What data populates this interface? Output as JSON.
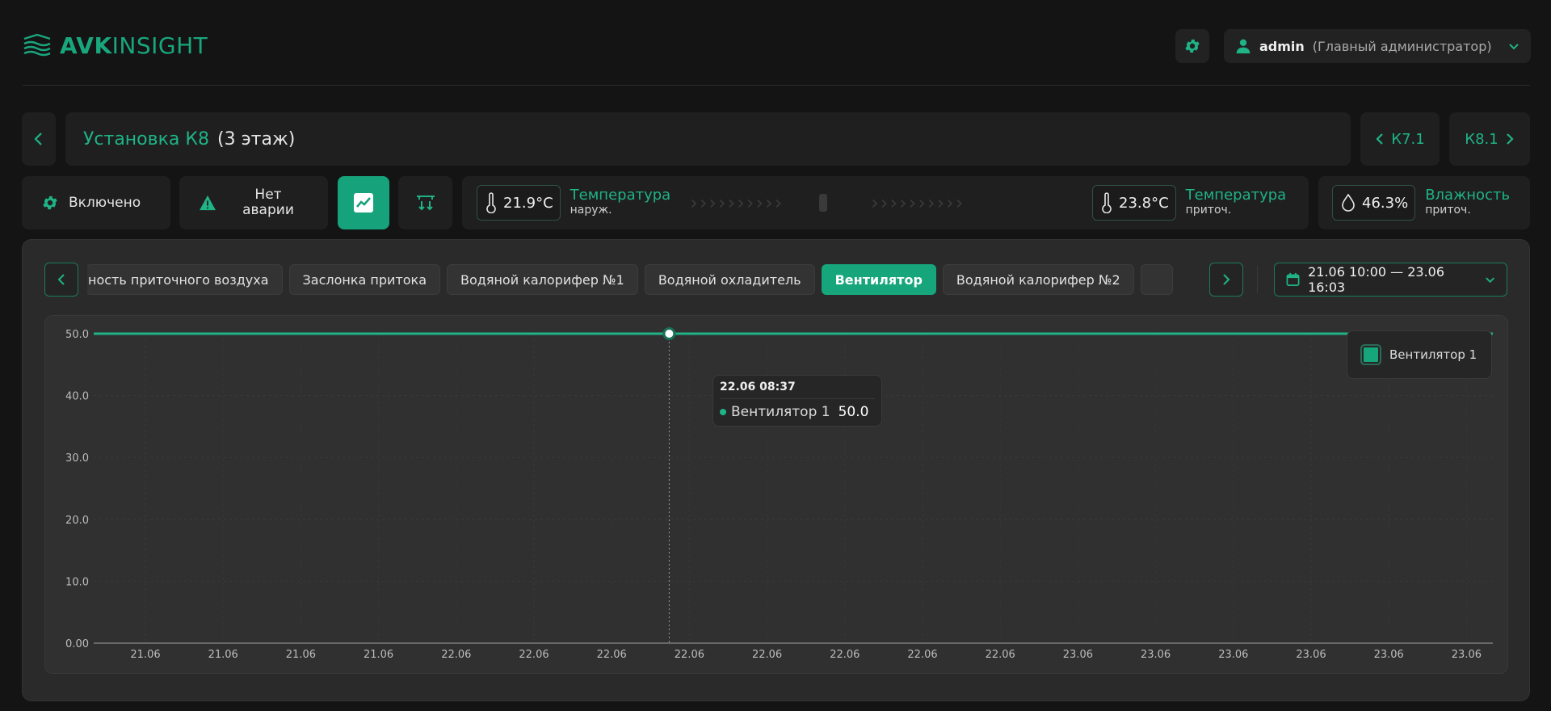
{
  "app": {
    "logo_bold": "AVK",
    "logo_thin": "INSIGHT"
  },
  "user": {
    "name": "admin",
    "role": "(Главный администратор)"
  },
  "unit": {
    "name": "Установка К8",
    "floor": "(3 этаж)",
    "prev": "К7.1",
    "next": "К8.1"
  },
  "status": {
    "power": "Включено",
    "alarm": "Нет аварии"
  },
  "metrics": {
    "outdoor_temp": {
      "value": "21.9°C",
      "label": "Температура",
      "sub": "наруж."
    },
    "supply_temp": {
      "value": "23.8°C",
      "label": "Температура",
      "sub": "приточ."
    },
    "supply_humidity": {
      "value": "46.3%",
      "label": "Влажность",
      "sub": "приточ."
    }
  },
  "tabs": [
    {
      "label": "ность приточного воздуха",
      "active": false
    },
    {
      "label": "Заслонка притока",
      "active": false
    },
    {
      "label": "Водяной калорифер №1",
      "active": false
    },
    {
      "label": "Водяной охладитель",
      "active": false
    },
    {
      "label": "Вентилятор",
      "active": true
    },
    {
      "label": "Водяной калорифер №2",
      "active": false
    },
    {
      "label": "",
      "active": false
    }
  ],
  "date_range": "21.06 10:00 — 23.06 16:03",
  "tooltip": {
    "date": "22.06 08:37",
    "series": "Вентилятор 1",
    "value": "50.0"
  },
  "legend": {
    "label": "Вентилятор 1"
  },
  "colors": {
    "accent": "#17a67c",
    "line": "#1fb386"
  },
  "icons": {
    "logo": "waves-logo-icon",
    "settings": "gear-icon",
    "user": "user-icon",
    "power": "gear-icon",
    "alarm": "warning-icon",
    "chart": "chart-line-icon",
    "flow": "flow-icon",
    "thermometer": "thermometer-icon",
    "drop": "drop-icon",
    "calendar": "calendar-icon"
  },
  "chart_data": {
    "type": "line",
    "ylim": [
      0,
      50
    ],
    "y_ticks": [
      "0.00",
      "10.0",
      "20.0",
      "30.0",
      "40.0",
      "50.0"
    ],
    "x_ticks": [
      "21.06",
      "21.06",
      "21.06",
      "21.06",
      "22.06",
      "22.06",
      "22.06",
      "22.06",
      "22.06",
      "22.06",
      "22.06",
      "22.06",
      "23.06",
      "23.06",
      "23.06",
      "23.06",
      "23.06",
      "23.06"
    ],
    "series": [
      {
        "name": "Вентилятор 1",
        "values": [
          50,
          50,
          50,
          50,
          50,
          50,
          50,
          50,
          50,
          50,
          50,
          50,
          50,
          50,
          50,
          50,
          50,
          50
        ]
      }
    ],
    "highlight_index": 7,
    "grid": true,
    "legend": "top-right"
  }
}
